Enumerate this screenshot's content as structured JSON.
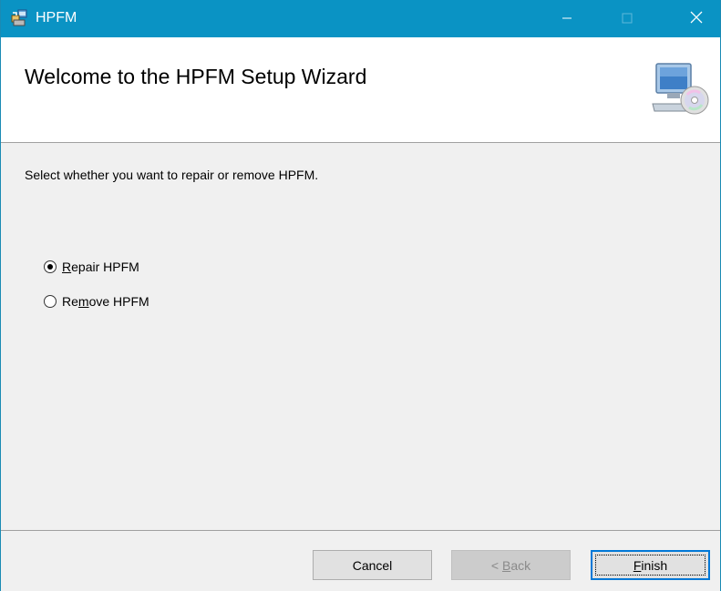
{
  "window": {
    "title": "HPFM",
    "minimize_icon": "minimize-icon",
    "maximize_icon": "maximize-icon",
    "close_icon": "close-icon"
  },
  "header": {
    "title": "Welcome to the HPFM Setup Wizard",
    "icon": "computer-cd-icon"
  },
  "content": {
    "instruction": "Select whether you want to repair or remove HPFM.",
    "options": [
      {
        "label_pre": "",
        "mnemonic": "R",
        "label_post": "epair HPFM",
        "selected": true
      },
      {
        "label_pre": "Re",
        "mnemonic": "m",
        "label_post": "ove HPFM",
        "selected": false
      }
    ]
  },
  "buttons": {
    "cancel": "Cancel",
    "back_prefix": "< ",
    "back_mnemonic": "B",
    "back_rest": "ack",
    "finish_mnemonic": "F",
    "finish_rest": "inish"
  },
  "colors": {
    "titlebar": "#0a93c4",
    "focus": "#0078d7"
  }
}
